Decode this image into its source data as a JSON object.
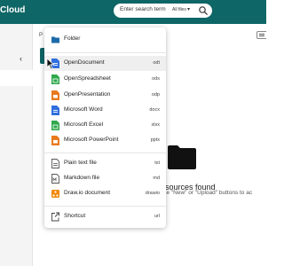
{
  "app": {
    "brand": "Cloud"
  },
  "search": {
    "placeholder": "Enter search term",
    "filter": "All files",
    "caret": "▾"
  },
  "sidebar": {
    "collapse_glyph": "‹"
  },
  "breadcrumb": {
    "first_letter": "P"
  },
  "empty_state": {
    "title": "sources found",
    "subtitle": "the \"New\" or \"Upload\" buttons to ac"
  },
  "menu": {
    "folder": {
      "label": "Folder",
      "icon": "folder-icon"
    },
    "documents": [
      {
        "label": "OpenDocument",
        "ext": "odt",
        "icon": "document-icon",
        "color": "#2f6fde"
      },
      {
        "label": "OpenSpreadsheet",
        "ext": "ods",
        "icon": "spreadsheet-icon",
        "color": "#2ea84b"
      },
      {
        "label": "OpenPresentation",
        "ext": "odp",
        "icon": "presentation-icon",
        "color": "#e87a1d"
      },
      {
        "label": "Microsoft Word",
        "ext": "docx",
        "icon": "document-icon",
        "color": "#2f6fde"
      },
      {
        "label": "Microsoft Excel",
        "ext": "xlsx",
        "icon": "spreadsheet-icon",
        "color": "#2ea84b"
      },
      {
        "label": "Microsoft PowerPoint",
        "ext": "pptx",
        "icon": "presentation-icon",
        "color": "#e87a1d"
      }
    ],
    "text_files": [
      {
        "label": "Plain text file",
        "ext": "txt",
        "icon": "text-file-icon"
      },
      {
        "label": "Markdown file",
        "ext": "md",
        "icon": "markdown-file-icon"
      },
      {
        "label": "Draw.io document",
        "ext": "drawio",
        "icon": "drawio-icon",
        "color": "#f08705"
      }
    ],
    "shortcut": {
      "label": "Shortcut",
      "ext": "url",
      "icon": "shortcut-icon"
    }
  },
  "colors": {
    "accent": "#0f6666",
    "word": "#2f6fde",
    "excel": "#2ea84b",
    "powerpoint": "#e87a1d",
    "folder": "#1d6aa8"
  }
}
